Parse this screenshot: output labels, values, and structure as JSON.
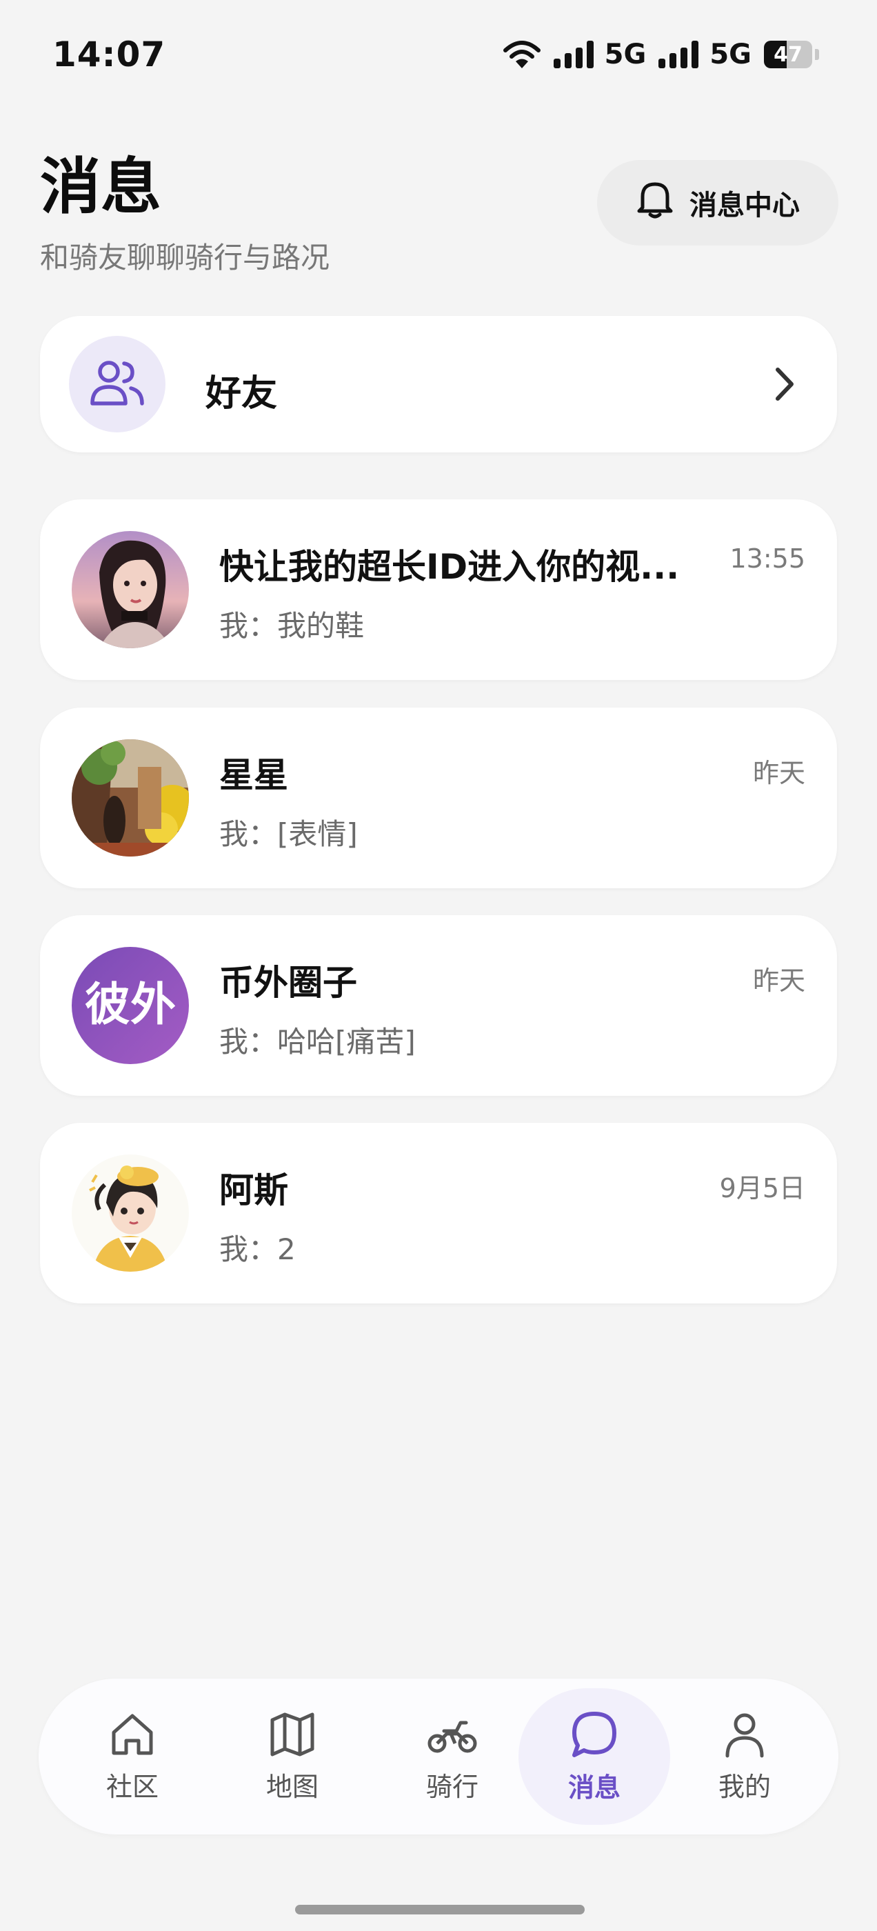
{
  "status_bar": {
    "time": "14:07",
    "network_1": "5G",
    "network_2": "5G",
    "battery": "47",
    "battery_level_percent": 47
  },
  "header": {
    "title": "消息",
    "subtitle": "和骑友聊聊骑行与路况",
    "message_center_label": "消息中心"
  },
  "friends": {
    "label": "好友"
  },
  "conversations": [
    {
      "name": "快让我的超长ID进入你的视...",
      "time": "13:55",
      "preview": "我：我的鞋",
      "avatar": "avatar-photo-girl"
    },
    {
      "name": "星星",
      "time": "昨天",
      "preview": "我：[表情]",
      "avatar": "avatar-photo-street"
    },
    {
      "name": "币外圈子",
      "time": "昨天",
      "preview": "我：哈哈[痛苦]",
      "avatar": "avatar-logo-text",
      "avatar_text": "彼外"
    },
    {
      "name": "阿斯",
      "time": "9月5日",
      "preview": "我：2",
      "avatar": "avatar-illustration"
    }
  ],
  "bottom_nav": {
    "items": [
      {
        "label": "社区",
        "icon": "home-icon"
      },
      {
        "label": "地图",
        "icon": "map-icon"
      },
      {
        "label": "骑行",
        "icon": "motorbike-icon"
      },
      {
        "label": "消息",
        "icon": "chat-bubble-icon"
      },
      {
        "label": "我的",
        "icon": "user-icon"
      }
    ],
    "active": "消息"
  },
  "colors": {
    "accent": "#6a4fc6",
    "background": "#f4f4f4",
    "card": "#ffffff"
  }
}
